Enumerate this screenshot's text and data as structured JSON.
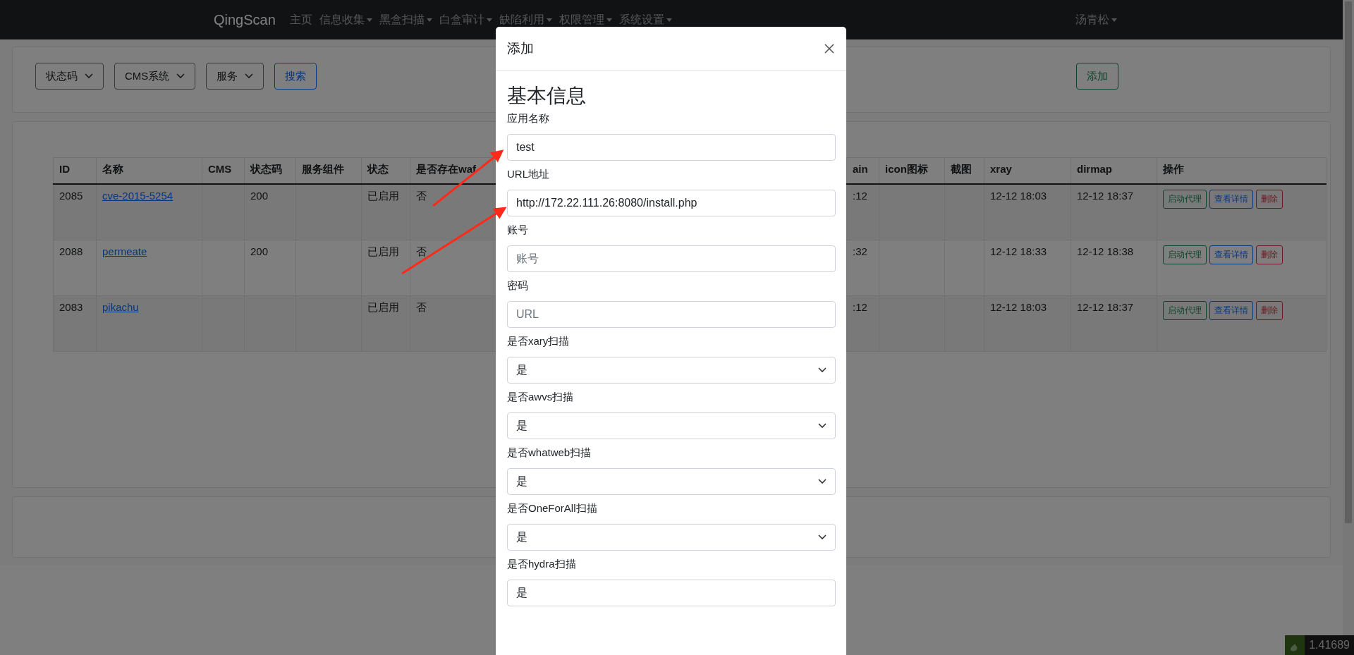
{
  "navbar": {
    "brand": "QingScan",
    "items": [
      {
        "label": "主页",
        "dropdown": false
      },
      {
        "label": "信息收集",
        "dropdown": true
      },
      {
        "label": "黑盒扫描",
        "dropdown": true
      },
      {
        "label": "白盒审计",
        "dropdown": true
      },
      {
        "label": "缺陷利用",
        "dropdown": true
      },
      {
        "label": "权限管理",
        "dropdown": true
      },
      {
        "label": "系统设置",
        "dropdown": true
      }
    ],
    "user": "汤青松"
  },
  "filters": {
    "dropdowns": [
      "状态码",
      "CMS系统",
      "服务"
    ],
    "search_button": "搜索",
    "add_button": "添加"
  },
  "table": {
    "columns": [
      "ID",
      "名称",
      "CMS",
      "状态码",
      "服务组件",
      "状态",
      "是否存在waf",
      "",
      "ain",
      "icon图标",
      "截图",
      "xray",
      "dirmap",
      "操作"
    ],
    "rows": [
      {
        "id": "2085",
        "name": "cve-2015-5254",
        "cms": "",
        "status_code": "200",
        "service": "",
        "state": "已启用",
        "waf": "否",
        "column_9": ":12",
        "icon": "",
        "screenshot": "",
        "xray": "12-12 18:03",
        "dirmap": "12-12 18:37",
        "actions": [
          "启动代理",
          "查看详情",
          "删除"
        ]
      },
      {
        "id": "2088",
        "name": "permeate",
        "cms": "",
        "status_code": "200",
        "service": "",
        "state": "已启用",
        "waf": "否",
        "column_9": ":32",
        "icon": "",
        "screenshot": "",
        "xray": "12-12 18:33",
        "dirmap": "12-12 18:38",
        "actions": [
          "启动代理",
          "查看详情",
          "删除"
        ]
      },
      {
        "id": "2083",
        "name": "pikachu",
        "cms": "",
        "status_code": "",
        "service": "",
        "state": "已启用",
        "waf": "否",
        "column_9": ":12",
        "icon": "",
        "screenshot": "",
        "xray": "12-12 18:03",
        "dirmap": "12-12 18:37",
        "actions": [
          "启动代理",
          "查看详情",
          "删除"
        ]
      }
    ]
  },
  "modal": {
    "title": "添加",
    "section": "基本信息",
    "fields": [
      {
        "kind": "text",
        "label": "应用名称",
        "value": "test"
      },
      {
        "kind": "text",
        "label": "URL地址",
        "value": "http://172.22.111.26:8080/install.php"
      },
      {
        "kind": "text",
        "label": "账号",
        "placeholder": "账号"
      },
      {
        "kind": "text",
        "label": "密码",
        "placeholder": "URL"
      },
      {
        "kind": "select",
        "label": "是否xary扫描",
        "value": "是"
      },
      {
        "kind": "select",
        "label": "是否awvs扫描",
        "value": "是"
      },
      {
        "kind": "select",
        "label": "是否whatweb扫描",
        "value": "是"
      },
      {
        "kind": "select",
        "label": "是否OneForAll扫描",
        "value": "是"
      },
      {
        "kind": "text",
        "label": "是否hydra扫描",
        "value": "是"
      }
    ]
  },
  "tray_widget": {
    "text": "1.41689"
  }
}
